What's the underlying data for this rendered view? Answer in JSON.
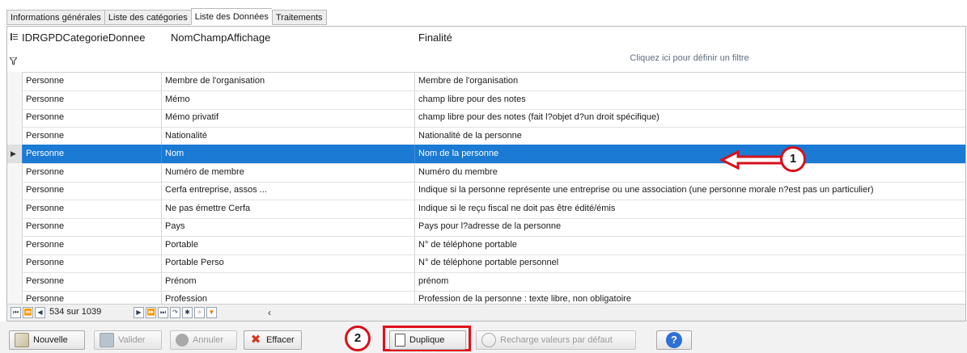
{
  "tabs": [
    "Informations générales",
    "Liste des catégories",
    "Liste des Données",
    "Traitements"
  ],
  "active_tab": 2,
  "grid": {
    "columns": [
      "IDRGPDCategorieDonnee",
      "NomChampAffichage",
      "Finalité"
    ],
    "filter_hint": "Cliquez ici pour définir un filtre",
    "rows": [
      {
        "c1": "Personne",
        "c2": "Membre de l'organisation",
        "c3": "Membre de l'organisation"
      },
      {
        "c1": "Personne",
        "c2": "Mémo",
        "c3": "champ libre pour des notes"
      },
      {
        "c1": "Personne",
        "c2": "Mémo privatif",
        "c3": "champ libre pour des notes (fait l?objet d?un droit spécifique)"
      },
      {
        "c1": "Personne",
        "c2": "Nationalité",
        "c3": "Nationalité de la personne"
      },
      {
        "c1": "Personne",
        "c2": "Nom",
        "c3": "Nom de la personne"
      },
      {
        "c1": "Personne",
        "c2": "Numéro de membre",
        "c3": "Numéro du membre"
      },
      {
        "c1": "Personne",
        "c2": "Cerfa entreprise, assos ...",
        "c3": "Indique si la personne représente une entreprise ou une association (une personne morale n?est pas un particulier)"
      },
      {
        "c1": "Personne",
        "c2": "Ne pas émettre Cerfa",
        "c3": "Indique si le reçu fiscal ne doit pas être édité/émis"
      },
      {
        "c1": "Personne",
        "c2": "Pays",
        "c3": "Pays pour l?adresse de la personne"
      },
      {
        "c1": "Personne",
        "c2": "Portable",
        "c3": "N° de téléphone portable"
      },
      {
        "c1": "Personne",
        "c2": "Portable Perso",
        "c3": "N° de téléphone portable personnel"
      },
      {
        "c1": "Personne",
        "c2": "Prénom",
        "c3": "prénom"
      },
      {
        "c1": "Personne",
        "c2": "Profession",
        "c3": "Profession de la personne : texte libre, non obligatoire"
      }
    ],
    "selected_row": 4
  },
  "navigator": {
    "position_label": "534 sur 1039",
    "buttons": [
      "first-icon",
      "prev-page-icon",
      "prev-icon",
      "next-icon",
      "next-page-icon",
      "last-icon",
      "refresh-icon",
      "asterisk-icon",
      "asterisk-disabled-icon",
      "filter-icon"
    ]
  },
  "buttons": {
    "nouvelle": "Nouvelle",
    "valider": "Valider",
    "annuler": "Annuler",
    "effacer": "Effacer",
    "duplique": "Duplique",
    "recharge": "Recharge valeurs par défaut"
  },
  "callouts": {
    "one": "1",
    "two": "2"
  },
  "colors": {
    "selection": "#1a7ad4",
    "callout_red": "#d6111b",
    "help_blue": "#2f6fd6"
  }
}
